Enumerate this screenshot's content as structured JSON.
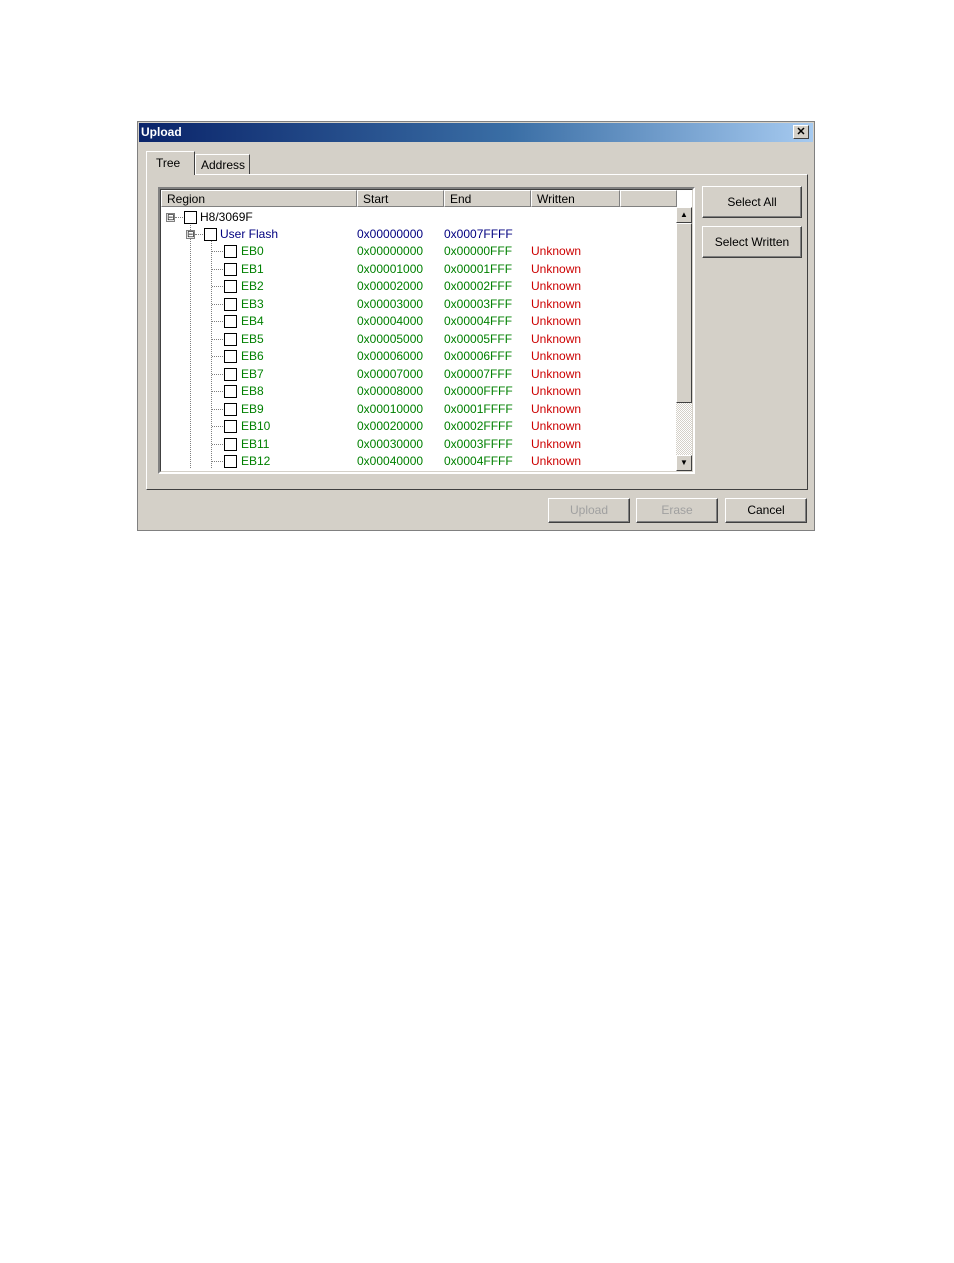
{
  "window": {
    "title": "Upload"
  },
  "tabs": [
    {
      "label": "Tree",
      "active": true
    },
    {
      "label": "Address",
      "active": false
    }
  ],
  "columns": [
    "Region",
    "Start",
    "End",
    "Written"
  ],
  "colors": {
    "root": "#000000",
    "group": "#000080",
    "leaf": "#008000",
    "written": "#cc0000"
  },
  "tree": {
    "root": {
      "name": "H8/3069F",
      "expander": "⊟"
    },
    "group": {
      "name": "User Flash",
      "start": "0x00000000",
      "end": "0x0007FFFF",
      "expander": "⊟"
    },
    "blocks": [
      {
        "name": "EB0",
        "start": "0x00000000",
        "end": "0x00000FFF",
        "written": "Unknown"
      },
      {
        "name": "EB1",
        "start": "0x00001000",
        "end": "0x00001FFF",
        "written": "Unknown"
      },
      {
        "name": "EB2",
        "start": "0x00002000",
        "end": "0x00002FFF",
        "written": "Unknown"
      },
      {
        "name": "EB3",
        "start": "0x00003000",
        "end": "0x00003FFF",
        "written": "Unknown"
      },
      {
        "name": "EB4",
        "start": "0x00004000",
        "end": "0x00004FFF",
        "written": "Unknown"
      },
      {
        "name": "EB5",
        "start": "0x00005000",
        "end": "0x00005FFF",
        "written": "Unknown"
      },
      {
        "name": "EB6",
        "start": "0x00006000",
        "end": "0x00006FFF",
        "written": "Unknown"
      },
      {
        "name": "EB7",
        "start": "0x00007000",
        "end": "0x00007FFF",
        "written": "Unknown"
      },
      {
        "name": "EB8",
        "start": "0x00008000",
        "end": "0x0000FFFF",
        "written": "Unknown"
      },
      {
        "name": "EB9",
        "start": "0x00010000",
        "end": "0x0001FFFF",
        "written": "Unknown"
      },
      {
        "name": "EB10",
        "start": "0x00020000",
        "end": "0x0002FFFF",
        "written": "Unknown"
      },
      {
        "name": "EB11",
        "start": "0x00030000",
        "end": "0x0003FFFF",
        "written": "Unknown"
      },
      {
        "name": "EB12",
        "start": "0x00040000",
        "end": "0x0004FFFF",
        "written": "Unknown"
      }
    ]
  },
  "buttons": {
    "select_all": "Select All",
    "select_written": "Select Written",
    "upload": "Upload",
    "erase": "Erase",
    "cancel": "Cancel"
  },
  "icons": {
    "close": "close-icon",
    "scroll_up": "scroll-up-arrow-icon",
    "scroll_down": "scroll-down-arrow-icon"
  }
}
